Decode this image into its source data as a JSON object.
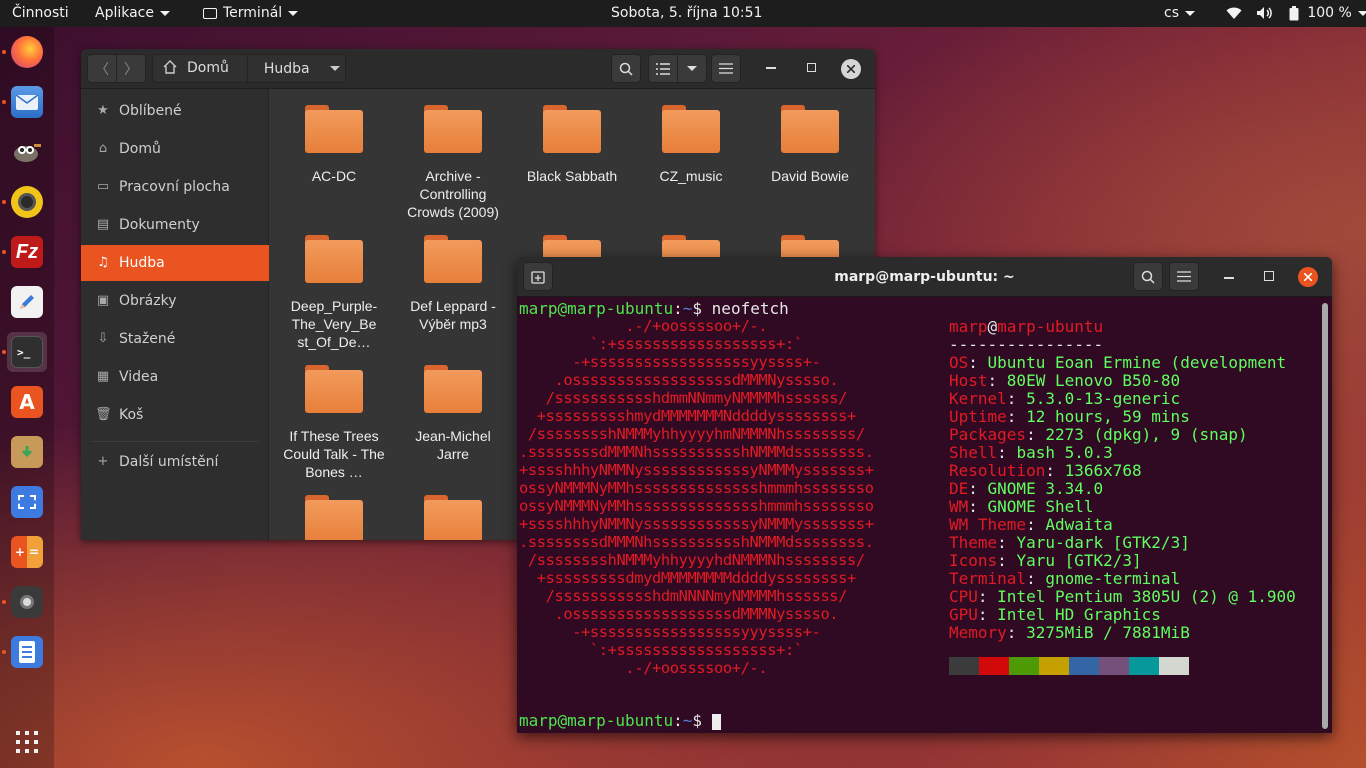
{
  "topbar": {
    "activities": "Činnosti",
    "apps_menu": "Aplikace",
    "app_name": "Terminál",
    "clock": "Sobota, 5. října  10:51",
    "keyboard_layout": "cs",
    "battery": "100 %"
  },
  "dock": {
    "items": [
      "firefox-icon",
      "mail-icon",
      "gimp-icon",
      "rhythmbox-icon",
      "filezilla-icon",
      "text-editor-icon",
      "terminal-icon",
      "software-center-icon",
      "archive-manager-icon",
      "screenshot-icon",
      "calculator-icon",
      "webcam-icon",
      "file-manager-icon",
      "show-applications-icon"
    ]
  },
  "files": {
    "path": [
      "Domů",
      "Hudba"
    ],
    "sidebar": [
      {
        "label": "Oblíbené",
        "icon": "star-icon"
      },
      {
        "label": "Domů",
        "icon": "home-icon"
      },
      {
        "label": "Pracovní plocha",
        "icon": "desktop-icon"
      },
      {
        "label": "Dokumenty",
        "icon": "documents-icon"
      },
      {
        "label": "Hudba",
        "icon": "music-icon"
      },
      {
        "label": "Obrázky",
        "icon": "pictures-icon"
      },
      {
        "label": "Stažené",
        "icon": "downloads-icon"
      },
      {
        "label": "Videa",
        "icon": "videos-icon"
      },
      {
        "label": "Koš",
        "icon": "trash-icon"
      },
      {
        "label": "Další umístění",
        "icon": "plus-icon"
      }
    ],
    "folders": [
      "AC-DC",
      "Archive - Controlling Crowds (2009)",
      "Black Sabbath",
      "CZ_music",
      "David Bowie",
      "Deep_Purple-The_Very_Best_Of_De…",
      "Def Leppard - Výběr mp3",
      "",
      "",
      "",
      "If These Trees Could Talk - The Bones …",
      "Jean-Michel Jarre"
    ]
  },
  "terminal": {
    "title": "marp@marp-ubuntu: ~",
    "prompt_user": "marp@marp-ubuntu",
    "prompt_path": "~",
    "command": "neofetch",
    "info_user": "marp",
    "info_host": "marp-ubuntu",
    "separator": "----------------",
    "info": [
      {
        "key": "OS",
        "value": "Ubuntu Eoan Ermine (development"
      },
      {
        "key": "Host",
        "value": "80EW Lenovo B50-80"
      },
      {
        "key": "Kernel",
        "value": "5.3.0-13-generic"
      },
      {
        "key": "Uptime",
        "value": "12 hours, 59 mins"
      },
      {
        "key": "Packages",
        "value": "2273 (dpkg), 9 (snap)"
      },
      {
        "key": "Shell",
        "value": "bash 5.0.3"
      },
      {
        "key": "Resolution",
        "value": "1366x768"
      },
      {
        "key": "DE",
        "value": "GNOME 3.34.0"
      },
      {
        "key": "WM",
        "value": "GNOME Shell"
      },
      {
        "key": "WM Theme",
        "value": "Adwaita"
      },
      {
        "key": "Theme",
        "value": "Yaru-dark [GTK2/3]"
      },
      {
        "key": "Icons",
        "value": "Yaru [GTK2/3]"
      },
      {
        "key": "Terminal",
        "value": "gnome-terminal"
      },
      {
        "key": "CPU",
        "value": "Intel Pentium 3805U (2) @ 1.900"
      },
      {
        "key": "GPU",
        "value": "Intel HD Graphics"
      },
      {
        "key": "Memory",
        "value": "3275MiB / 7881MiB"
      }
    ],
    "logo": [
      "            .-/+oossssoo+/-.",
      "        `:+ssssssssssssssssss+:`",
      "      -+ssssssssssssssssssyyssss+-",
      "    .ossssssssssssssssssdMMMNysssso.",
      "   /ssssssssssshdmmNNmmyNMMMMhssssss/",
      "  +ssssssssshmydMMMMMMMNddddyssssssss+",
      " /sssssssshNMMMyhhyyyyhmNMMMNhssssssss/",
      ".ssssssssdMMMNhsssssssssshNMMMdssssssss.",
      "+sssshhhyNMMNyssssssssssssyNMMMysssssss+",
      "ossyNMMMNyMMhsssssssssssssshmmmhssssssso",
      "ossyNMMMNyMMhsssssssssssssshmmmhssssssso",
      "+sssshhhyNMMNyssssssssssssyNMMMysssssss+",
      ".ssssssssdMMMNhsssssssssshNMMMdssssssss.",
      " /sssssssshNMMMyhhyyyyhdNMMMNhssssssss/",
      "  +sssssssssdmydMMMMMMMMddddyssssssss+",
      "   /ssssssssssshdmNNNNmyNMMMMhssssss/",
      "    .ossssssssssssssssssdMMMNysssso.",
      "      -+sssssssssssssssssyyyssss+-",
      "        `:+ssssssssssssssssss+:`",
      "            .-/+oossssoo+/-."
    ],
    "palette": [
      "#3b3b3b",
      "#d10909",
      "#4e9a06",
      "#c4a000",
      "#3465a4",
      "#75507b",
      "#06989a",
      "#d3d7cf"
    ]
  }
}
